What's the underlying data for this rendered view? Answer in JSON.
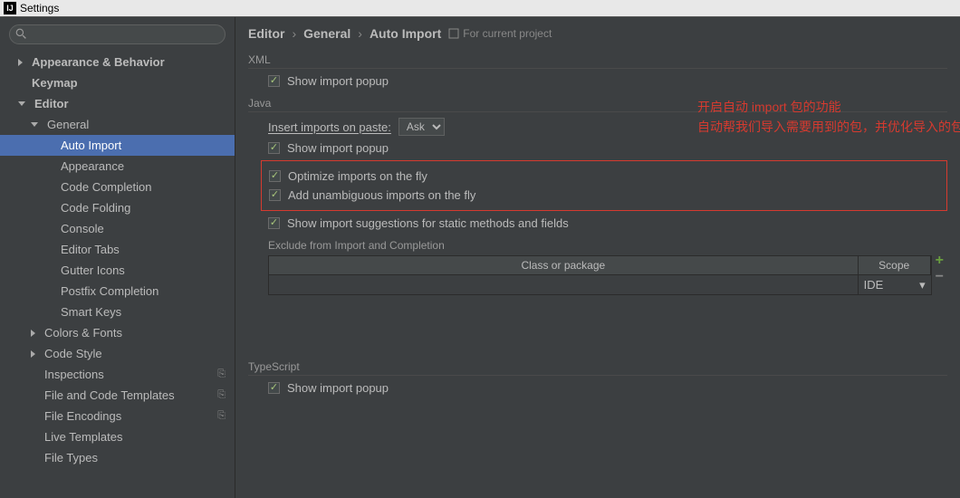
{
  "window": {
    "title": "Settings",
    "logo_text": "IJ"
  },
  "search": {
    "placeholder": ""
  },
  "sidebar": {
    "items": [
      {
        "label": "Appearance & Behavior",
        "level": 0,
        "arrow": "right",
        "bold": true
      },
      {
        "label": "Keymap",
        "level": 0,
        "arrow": null,
        "bold": true
      },
      {
        "label": "Editor",
        "level": 0,
        "arrow": "down",
        "bold": true
      },
      {
        "label": "General",
        "level": 1,
        "arrow": "down",
        "bold": false
      },
      {
        "label": "Auto Import",
        "level": 2,
        "arrow": null,
        "selected": true
      },
      {
        "label": "Appearance",
        "level": 2,
        "arrow": null
      },
      {
        "label": "Code Completion",
        "level": 2,
        "arrow": null
      },
      {
        "label": "Code Folding",
        "level": 2,
        "arrow": null
      },
      {
        "label": "Console",
        "level": 2,
        "arrow": null
      },
      {
        "label": "Editor Tabs",
        "level": 2,
        "arrow": null
      },
      {
        "label": "Gutter Icons",
        "level": 2,
        "arrow": null
      },
      {
        "label": "Postfix Completion",
        "level": 2,
        "arrow": null
      },
      {
        "label": "Smart Keys",
        "level": 2,
        "arrow": null
      },
      {
        "label": "Colors & Fonts",
        "level": 1,
        "arrow": "right"
      },
      {
        "label": "Code Style",
        "level": 1,
        "arrow": "right"
      },
      {
        "label": "Inspections",
        "level": 1,
        "arrow": null,
        "badge": "⎘"
      },
      {
        "label": "File and Code Templates",
        "level": 1,
        "arrow": null,
        "badge": "⎘"
      },
      {
        "label": "File Encodings",
        "level": 1,
        "arrow": null,
        "badge": "⎘"
      },
      {
        "label": "Live Templates",
        "level": 1,
        "arrow": null
      },
      {
        "label": "File Types",
        "level": 1,
        "arrow": null
      }
    ]
  },
  "breadcrumb": {
    "parts": [
      "Editor",
      "General",
      "Auto Import"
    ],
    "scope_label": "For current project"
  },
  "xml": {
    "section": "XML",
    "show_popup": "Show import popup"
  },
  "java": {
    "section": "Java",
    "insert_label": "Insert imports on paste:",
    "insert_value": "Ask",
    "show_popup": "Show import popup",
    "optimize": "Optimize imports on the fly",
    "unambiguous": "Add unambiguous imports on the fly",
    "suggestions": "Show import suggestions for static methods and fields",
    "exclude_label": "Exclude from Import and Completion",
    "col_class": "Class or package",
    "col_scope": "Scope",
    "scope_value": "IDE"
  },
  "typescript": {
    "section": "TypeScript",
    "show_popup": "Show import popup"
  },
  "annotation": {
    "line1": "开启自动 import 包的功能",
    "line2": "自动帮我们导入需要用到的包，并优化导入的包，比如自动去掉一些没有用到的包"
  }
}
